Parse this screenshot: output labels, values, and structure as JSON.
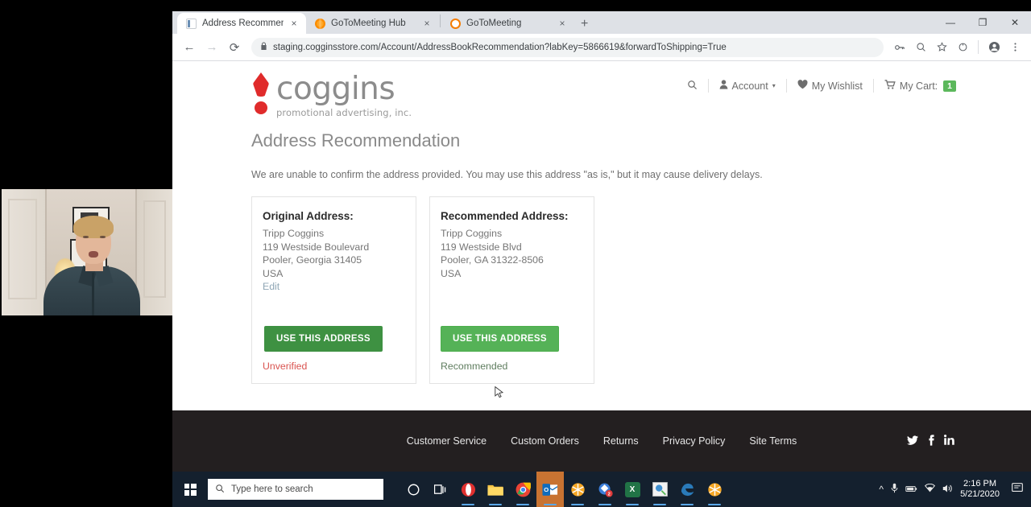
{
  "browser": {
    "tabs": [
      {
        "title": "Address Recommendation - Dem",
        "favicon": "document-icon",
        "active": true
      },
      {
        "title": "GoToMeeting Hub",
        "favicon": "gotomeeting-hub-icon",
        "active": false
      },
      {
        "title": "GoToMeeting",
        "favicon": "gotomeeting-icon",
        "active": false
      }
    ],
    "new_tab_label": "+",
    "close_label": "×",
    "window_controls": {
      "minimize": "—",
      "maximize": "❐",
      "close": "✕"
    },
    "nav": {
      "back": "←",
      "forward": "→",
      "reload": "⟳"
    },
    "url": "staging.cogginsstore.com/Account/AddressBookRecommendation?labKey=5866619&forwardToShipping=True",
    "lock_icon": "🔒",
    "toolbar_icons": [
      "key-icon",
      "zoom-icon",
      "bookmark-star-icon",
      "extension-icon",
      "profile-avatar-icon",
      "chrome-menu-icon"
    ]
  },
  "site": {
    "logo": {
      "word": "coggins",
      "tagline": "promotional advertising, inc."
    },
    "header_nav": {
      "search_icon": "search-icon",
      "account_label": "Account",
      "account_caret": "▾",
      "wishlist_label": "My Wishlist",
      "cart_label": "My Cart:",
      "cart_count": "1"
    },
    "page_title": "Address Recommendation",
    "page_description": "We are unable to confirm the address provided. You may use this address \"as is,\" but it may cause delivery delays.",
    "cards": [
      {
        "title": "Original Address:",
        "lines": [
          "Tripp Coggins",
          "119 Westside Boulevard",
          "Pooler, Georgia 31405",
          "USA"
        ],
        "edit_label": "Edit",
        "button_label": "USE THIS ADDRESS",
        "status": "Unverified",
        "status_color": "#d9534f",
        "hovered": true
      },
      {
        "title": "Recommended Address:",
        "lines": [
          "Tripp Coggins",
          "119 Westside Blvd",
          "Pooler, GA 31322-8506",
          "USA"
        ],
        "edit_label": "",
        "button_label": "USE THIS ADDRESS",
        "status": "Recommended",
        "status_color": "#5f7d5f",
        "hovered": false
      }
    ],
    "footer": {
      "links": [
        "Customer Service",
        "Custom Orders",
        "Returns",
        "Privacy Policy",
        "Site Terms"
      ],
      "social": [
        "twitter-icon",
        "facebook-icon",
        "linkedin-icon"
      ]
    },
    "accent_green": "#55b257",
    "accent_red": "#e02b2b"
  },
  "taskbar": {
    "search_placeholder": "Type here to search",
    "clock_time": "2:16 PM",
    "clock_date": "5/21/2020",
    "app_badge_count": "2"
  }
}
